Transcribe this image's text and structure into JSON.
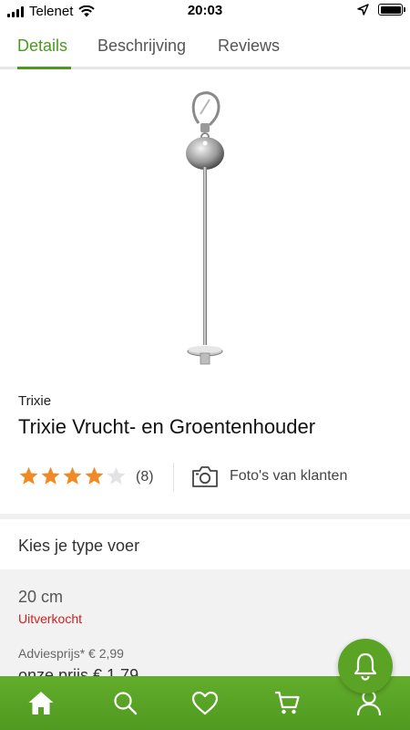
{
  "status_bar": {
    "carrier": "Telenet",
    "time": "20:03",
    "icons": [
      "signal-bars-icon",
      "wifi-icon",
      "location-arrow-icon",
      "battery-icon"
    ]
  },
  "tabs": [
    {
      "label": "Details",
      "active": true
    },
    {
      "label": "Beschrijving",
      "active": false
    },
    {
      "label": "Reviews",
      "active": false
    }
  ],
  "product": {
    "brand": "Trixie",
    "title": "Trixie Vrucht- en Groentenhouder",
    "rating": 4,
    "rating_max": 5,
    "review_count": "(8)",
    "photos_label": "Foto's van klanten"
  },
  "variant_section": {
    "title": "Kies je type voer",
    "variant": {
      "size": "20 cm",
      "status": "Uitverkocht",
      "advice_price": "Adviesprijs* € 2,99",
      "our_price": "onze prijs € 1,79"
    }
  },
  "bottom_nav": {
    "items": [
      "home-icon",
      "search-icon",
      "heart-icon",
      "cart-icon",
      "account-icon"
    ]
  },
  "colors": {
    "accent": "#4a9a1f",
    "nav_bg": "#5aa324",
    "star": "#f08a24",
    "soldout": "#d32020"
  }
}
